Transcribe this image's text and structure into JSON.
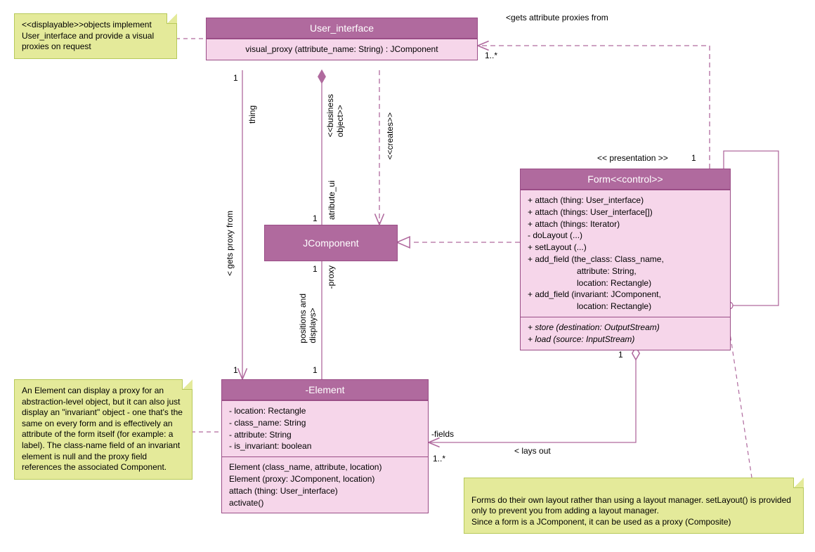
{
  "notes": {
    "displayable": "<<displayable>>objects implement User_interface and provide a visual proxies on request",
    "element_note": "An Element can display a proxy for an abstraction-level object, but it can also just display an \"invariant\" object - one that's the same on every form and is effectively an attribute of the form itself (for example: a label). The class-name field of an invariant element is null and the proxy field references the associated Component.",
    "form_note": "Forms do their own layout rather than using a layout manager. setLayout() is provided only to prevent you from adding a layout manager.\nSince a form is a JComponent, it can be used as a proxy (Composite)"
  },
  "classes": {
    "user_interface": {
      "title": "User_interface",
      "op1": "visual_proxy (attribute_name: String) : JComponent"
    },
    "jcomponent": {
      "title": "JComponent"
    },
    "element": {
      "title": "-Element",
      "attrs": "- location: Rectangle\n- class_name: String\n- attribute: String\n- is_invariant: boolean",
      "ops": "Element (class_name, attribute, location)\nElement (proxy: JComponent, location)\nattach (thing: User_interface)\nactivate()"
    },
    "form": {
      "title": "Form<<control>>",
      "ops_a": "+ attach (thing: User_interface)\n+ attach (things: User_interface[])\n+ attach (things: Iterator)\n- doLayout (...)\n+ setLayout (...)\n+ add_field (the_class: Class_name,\n                     attribute: String,\n                     location: Rectangle)\n+ add_field (invariant: JComponent,\n                     location: Rectangle)",
      "ops_b": "+ store (destination: OutputStream)\n+ load (source: InputStream)"
    }
  },
  "labels": {
    "gets_attr_proxies": "<gets attribute proxies from",
    "one": "1",
    "one_many": "1..*",
    "thing": "thing",
    "gets_proxy_from": "< gets proxy from",
    "business_object": "<<business\nobject>>",
    "atribute_ui": "atribute_ui",
    "creates": "<<creates>>",
    "presentation": "<< presentation >>",
    "positions_and_displays": "positions and\ndisplays>",
    "proxy": "-proxy",
    "fields": "-fields",
    "lays_out": "< lays out"
  }
}
